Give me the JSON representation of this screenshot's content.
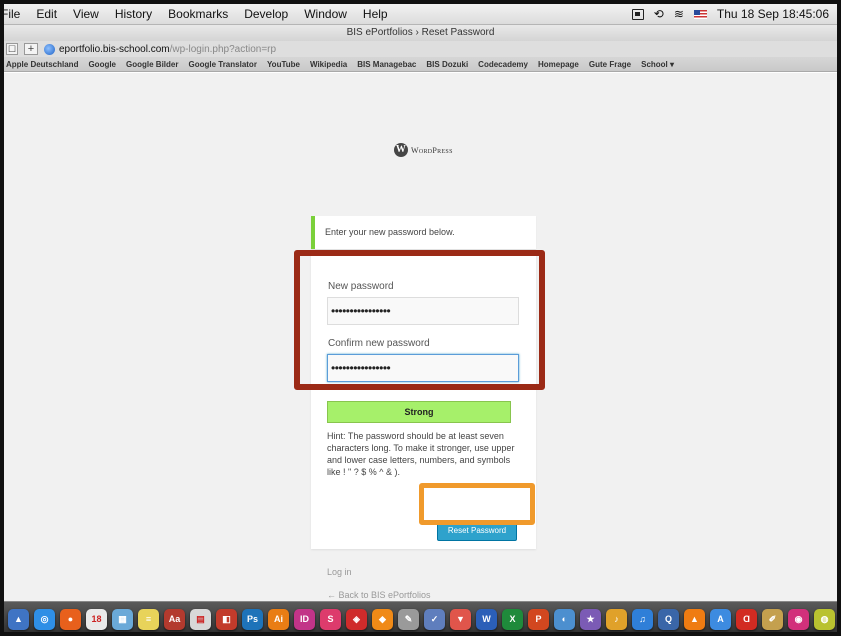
{
  "menubar": {
    "items": [
      "File",
      "Edit",
      "View",
      "History",
      "Bookmarks",
      "Develop",
      "Window",
      "Help"
    ],
    "clock": "Thu 18 Sep  18:45:06"
  },
  "window": {
    "title": "BIS ePortfolios › Reset Password"
  },
  "urlbar": {
    "domain": "eportfolio.bis-school.com",
    "path": "/wp-login.php?action=rp",
    "plus_label": "+"
  },
  "bookmarks": [
    "Apple Deutschland",
    "Google",
    "Google Bilder",
    "Google Translator",
    "YouTube",
    "Wikipedia",
    "BIS Managebac",
    "BIS Dozuki",
    "Codecademy",
    "Homepage",
    "Gute Frage",
    "School ▾"
  ],
  "page": {
    "logo_text": "WordPress",
    "message": "Enter your new password below.",
    "new_password_label": "New password",
    "new_password_value": "••••••••••••••••",
    "confirm_password_label": "Confirm new password",
    "confirm_password_value": "••••••••••••••••",
    "strength": "Strong",
    "hint": "Hint: The password should be at least seven characters long. To make it stronger, use upper and lower case letters, numbers, and symbols like ! \" ? $ % ^ & ).",
    "reset_button": "Reset Password",
    "login_link": "Log in",
    "back_link": "← Back to BIS ePortfolios"
  },
  "colors": {
    "success_border": "#7ad03a",
    "strength_bg": "#a6f06a",
    "button_bg": "#2ea2cc",
    "annotation_red": "#9b2a16",
    "annotation_orange": "#f09a2c"
  },
  "dock": [
    {
      "name": "preview-icon",
      "glyph": "▲",
      "color": "#3f74c4"
    },
    {
      "name": "safari-icon",
      "glyph": "◎",
      "color": "#2f8fe6"
    },
    {
      "name": "firefox-icon",
      "glyph": "●",
      "color": "#e8601c"
    },
    {
      "name": "calendar-icon",
      "glyph": "18",
      "color": "#e9e9e9"
    },
    {
      "name": "preview-photos-icon",
      "glyph": "▦",
      "color": "#6aa9d8"
    },
    {
      "name": "notes-icon",
      "glyph": "≡",
      "color": "#e8d35a"
    },
    {
      "name": "dictionary-icon",
      "glyph": "Aa",
      "color": "#b33a2e"
    },
    {
      "name": "textedit-icon",
      "glyph": "▤",
      "color": "#d8d8d8"
    },
    {
      "name": "photo-booth-icon",
      "glyph": "◧",
      "color": "#c23b2b"
    },
    {
      "name": "photoshop-icon",
      "glyph": "Ps",
      "color": "#1e73b9"
    },
    {
      "name": "illustrator-icon",
      "glyph": "Ai",
      "color": "#e97d14"
    },
    {
      "name": "indesign-icon",
      "glyph": "ID",
      "color": "#c23488"
    },
    {
      "name": "dreamweaver-icon",
      "glyph": "S",
      "color": "#dd3b6c"
    },
    {
      "name": "acrobat-icon",
      "glyph": "◈",
      "color": "#cf2b2b"
    },
    {
      "name": "vlc-icon",
      "glyph": "◆",
      "color": "#f08a17"
    },
    {
      "name": "pencil-icon",
      "glyph": "✎",
      "color": "#9a9a9a"
    },
    {
      "name": "script-icon",
      "glyph": "✓",
      "color": "#5f7ebd"
    },
    {
      "name": "stickies-icon",
      "glyph": "▼",
      "color": "#e0554b"
    },
    {
      "name": "word-icon",
      "glyph": "W",
      "color": "#2b5fb8"
    },
    {
      "name": "excel-icon",
      "glyph": "X",
      "color": "#1f8a3b"
    },
    {
      "name": "powerpoint-icon",
      "glyph": "P",
      "color": "#d2471f"
    },
    {
      "name": "screenflow-icon",
      "glyph": "◐",
      "color": "#4c8fcf"
    },
    {
      "name": "imovie-icon",
      "glyph": "★",
      "color": "#7b5bb5"
    },
    {
      "name": "garageband-icon",
      "glyph": "♪",
      "color": "#e0a12a"
    },
    {
      "name": "itunes-icon",
      "glyph": "♫",
      "color": "#2f7fd8"
    },
    {
      "name": "quicktime-icon",
      "glyph": "Q",
      "color": "#3a66a8"
    },
    {
      "name": "vlc-cone-icon",
      "glyph": "▲",
      "color": "#ef7c12"
    },
    {
      "name": "app-store-icon",
      "glyph": "A",
      "color": "#3d8be0"
    },
    {
      "name": "adobe-reader-icon",
      "glyph": "Ɑ",
      "color": "#d22b22"
    },
    {
      "name": "scripting-icon",
      "glyph": "✐",
      "color": "#c4a04e"
    },
    {
      "name": "lips-icon",
      "glyph": "◉",
      "color": "#d2307b"
    },
    {
      "name": "more-icon",
      "glyph": "◍",
      "color": "#b9c230"
    }
  ]
}
